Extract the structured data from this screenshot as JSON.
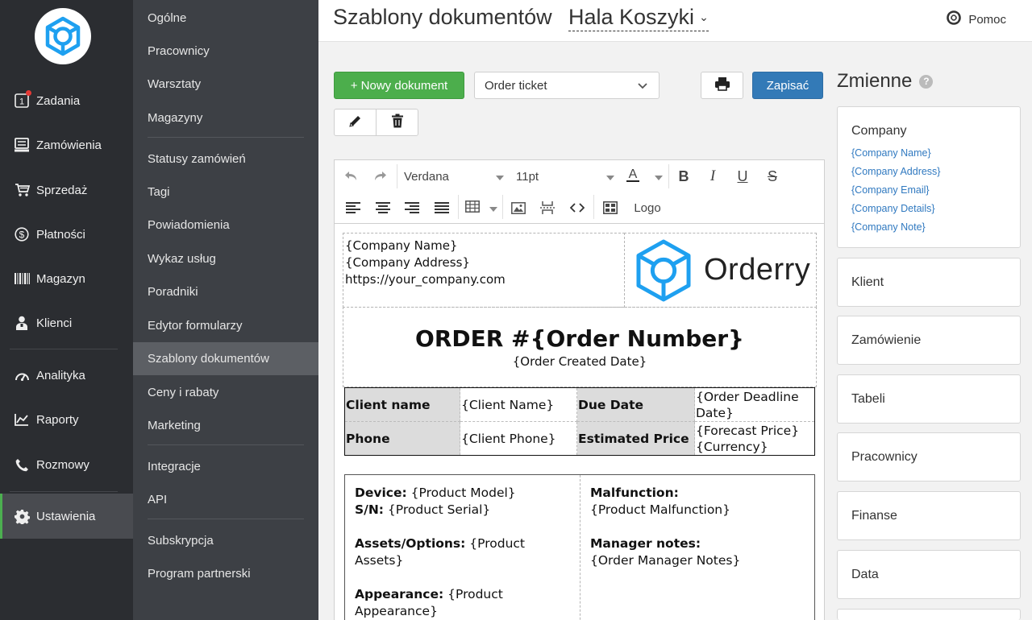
{
  "main_nav": {
    "items": [
      {
        "label": "Zadania",
        "icon": "tasks-icon"
      },
      {
        "label": "Zamówienia",
        "icon": "orders-icon"
      },
      {
        "label": "Sprzedaż",
        "icon": "cart-icon"
      },
      {
        "label": "Płatności",
        "icon": "dollar-icon"
      },
      {
        "label": "Magazyn",
        "icon": "barcode-icon"
      },
      {
        "label": "Klienci",
        "icon": "user-icon"
      },
      {
        "label": "Analityka",
        "icon": "gauge-icon"
      },
      {
        "label": "Raporty",
        "icon": "chart-icon"
      },
      {
        "label": "Rozmowy",
        "icon": "phone-icon"
      },
      {
        "label": "Ustawienia",
        "icon": "gear-icon"
      }
    ],
    "active": "Ustawienia",
    "accent": "#4caf50",
    "tasks_badge": "1"
  },
  "sub_nav": {
    "items": [
      "Ogólne",
      "Pracownicy",
      "Warsztaty",
      "Magazyny",
      "Statusy zamówień",
      "Tagi",
      "Powiadomienia",
      "Wykaz usług",
      "Poradniki",
      "Edytor formularzy",
      "Szablony dokumentów",
      "Ceny i rabaty",
      "Marketing",
      "Integracje",
      "API",
      "Subskrypcja",
      "Program partnerski"
    ],
    "active": "Szablony dokumentów"
  },
  "header": {
    "title": "Szablony dokumentów",
    "location": "Hala Koszyki",
    "help_label": "Pomoc"
  },
  "toolbar": {
    "new_doc_label": "+ Nowy dokument",
    "template_selected": "Order ticket",
    "save_label": "Zapisać",
    "new_color": "#4cae4c",
    "save_color": "#337ab7"
  },
  "editor": {
    "font_family": "Verdana",
    "font_size": "11pt",
    "logo_button": "Logo"
  },
  "document": {
    "company_name": "{Company Name}",
    "company_address": "{Company Address}",
    "company_url": "https://your_company.com",
    "brand": "Orderry",
    "order_title": "ORDER #{Order Number}",
    "order_date": "{Order Created Date}",
    "client_name_label": "Client name",
    "client_name_value": "{Client Name}",
    "due_date_label": "Due Date",
    "due_date_value": "{Order Deadline Date}",
    "phone_label": "Phone",
    "phone_value": "{Client Phone}",
    "est_price_label": "Estimated Price",
    "est_price_value": "{Forecast Price} {Currency}",
    "device_label": "Device:",
    "device_value": " {Product Model}",
    "sn_label": "S/N:",
    "sn_value": " {Product Serial}",
    "assets_label": "Assets/Options:",
    "assets_value": " {Product Assets}",
    "appearance_label": "Appearance:",
    "appearance_value": " {Product Appearance}",
    "malfunction_label": "Malfunction:",
    "malfunction_value": "{Product Malfunction}",
    "manager_notes_label": "Manager notes:",
    "manager_notes_value": "{Order Manager Notes}"
  },
  "variables": {
    "title": "Zmienne",
    "company": {
      "title": "Company",
      "links": [
        "{Company Name}",
        "{Company Address}",
        "{Company Email}",
        "{Company Details}",
        "{Company Note}"
      ]
    },
    "groups": [
      "Klient",
      "Zamówienie",
      "Tabeli",
      "Pracownicy",
      "Finanse",
      "Data"
    ]
  }
}
